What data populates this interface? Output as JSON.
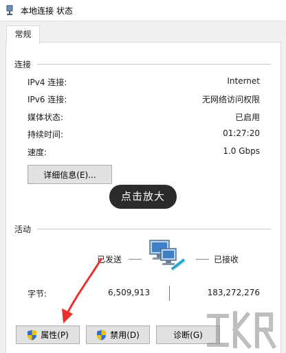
{
  "window": {
    "title": "本地连接 状态"
  },
  "tabs": [
    {
      "label": "常规"
    }
  ],
  "connection": {
    "section_label": "连接",
    "rows": [
      {
        "label": "IPv4 连接:",
        "value": "Internet"
      },
      {
        "label": "IPv6 连接:",
        "value": "无网络访问权限"
      },
      {
        "label": "媒体状态:",
        "value": "已启用"
      },
      {
        "label": "持续时间:",
        "value": "01:27:20"
      },
      {
        "label": "速度:",
        "value": "1.0 Gbps"
      }
    ],
    "details_button": "详细信息(E)..."
  },
  "overlay": {
    "zoom_hint": "点击放大"
  },
  "activity": {
    "section_label": "活动",
    "sent_label": "已发送",
    "received_label": "已接收",
    "bytes_label": "字节:",
    "bytes_sent": "6,509,913",
    "bytes_received": "183,272,276"
  },
  "buttons": {
    "properties": "属性(P)",
    "disable": "禁用(D)",
    "diagnose": "诊断(G)"
  },
  "icons": {
    "title": "network-adapter-icon",
    "activity": "network-computers-icon",
    "shield": "uac-shield-icon"
  },
  "colors": {
    "annotation_arrow": "#e8312a",
    "shield_blue": "#2f6fd6",
    "shield_yellow": "#f2c200"
  }
}
